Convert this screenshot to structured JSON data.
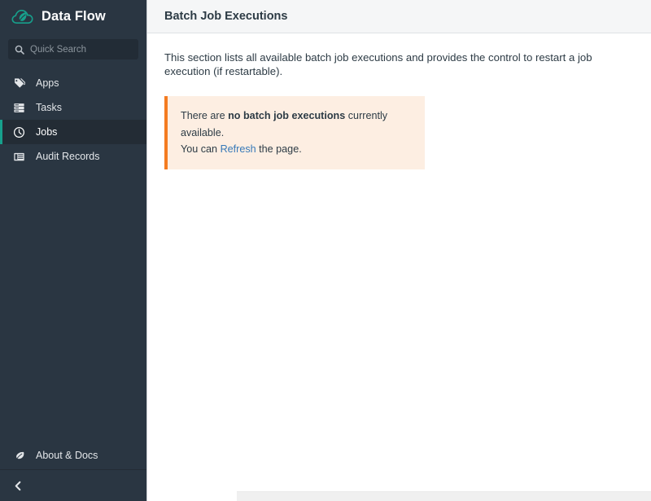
{
  "sidebar": {
    "brand": {
      "title": "Data Flow",
      "logo_icon": "cloud-leaf-logo",
      "logo_color": "#17a08c"
    },
    "search": {
      "placeholder": "Quick Search",
      "value": "",
      "icon": "search-icon"
    },
    "items": [
      {
        "label": "Apps",
        "icon": "tag-icon",
        "active": false
      },
      {
        "label": "Tasks",
        "icon": "server-stack-icon",
        "active": false
      },
      {
        "label": "Jobs",
        "icon": "clock-icon",
        "active": true
      },
      {
        "label": "Audit Records",
        "icon": "list-table-icon",
        "active": false
      }
    ],
    "about": {
      "label": "About & Docs",
      "icon": "leaf-icon"
    },
    "collapse": {
      "icon": "chevron-left-icon",
      "label": ""
    },
    "colors": {
      "background": "#2a3642",
      "active_background": "#232c35",
      "active_accent": "#17a08c",
      "search_background": "#222c36"
    }
  },
  "main": {
    "header": {
      "title": "Batch Job Executions"
    },
    "description": "This section lists all available batch job executions and provides the control to restart a job execution (if restartable).",
    "alert": {
      "line1_prefix": "There are ",
      "line1_strong": "no batch job executions",
      "line1_suffix": " currently available.",
      "line2_prefix": "You can ",
      "line2_link": "Refresh",
      "line2_suffix": " the page.",
      "accent_color": "#f47b20",
      "background_color": "#fdeee2",
      "link_color": "#3779b8"
    },
    "scrollbar": {
      "orientation": "horizontal"
    }
  }
}
